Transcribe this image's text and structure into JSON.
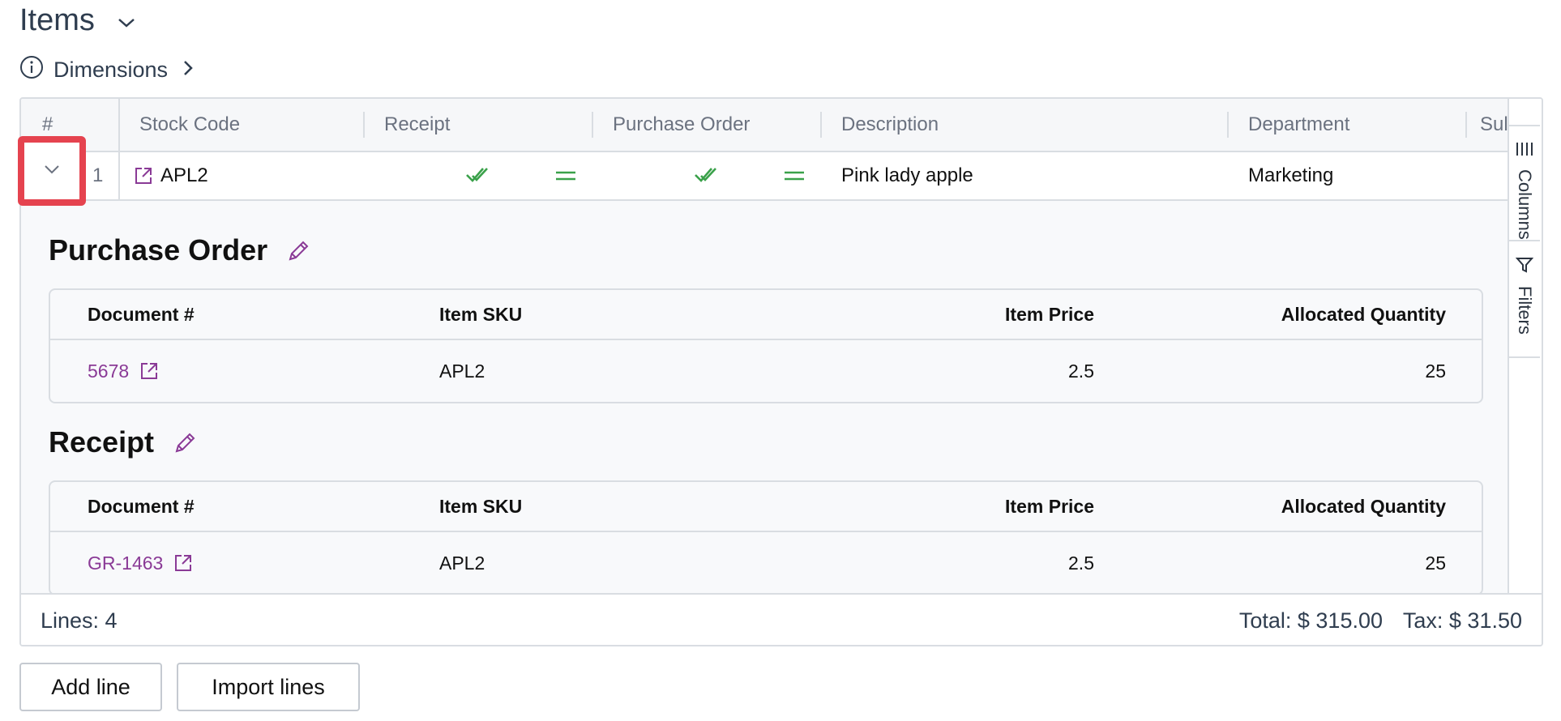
{
  "page": {
    "title": "Items",
    "dimensions_label": "Dimensions"
  },
  "grid": {
    "columns": [
      "#",
      "Stock Code",
      "Receipt",
      "Purchase Order",
      "Description",
      "Department",
      "Sul"
    ],
    "row": {
      "number": "1",
      "stock_code": "APL2",
      "description": "Pink lady apple",
      "department": "Marketing"
    },
    "sidebar": {
      "columns_label": "Columns",
      "filters_label": "Filters"
    }
  },
  "detail": {
    "purchase_order": {
      "title": "Purchase Order",
      "headers": [
        "Document #",
        "Item SKU",
        "Item Price",
        "Allocated Quantity"
      ],
      "row": {
        "document": "5678",
        "sku": "APL2",
        "price": "2.5",
        "quantity": "25"
      }
    },
    "receipt": {
      "title": "Receipt",
      "headers": [
        "Document #",
        "Item SKU",
        "Item Price",
        "Allocated Quantity"
      ],
      "row": {
        "document": "GR-1463",
        "sku": "APL2",
        "price": "2.5",
        "quantity": "25"
      }
    }
  },
  "footer": {
    "lines": "Lines: 4",
    "total": "Total: $ 315.00",
    "tax": "Tax: $ 31.50"
  },
  "buttons": {
    "add_line": "Add line",
    "import_lines": "Import lines"
  },
  "colors": {
    "accent": "#8a3a96",
    "success": "#3aa14a",
    "highlight": "#e5434f",
    "border": "#d9dde2"
  },
  "icons": [
    "chevron-down-icon",
    "info-icon",
    "chevron-right-icon",
    "external-link-icon",
    "double-check-icon",
    "equals-icon",
    "pencil-icon",
    "columns-icon",
    "filter-icon"
  ]
}
